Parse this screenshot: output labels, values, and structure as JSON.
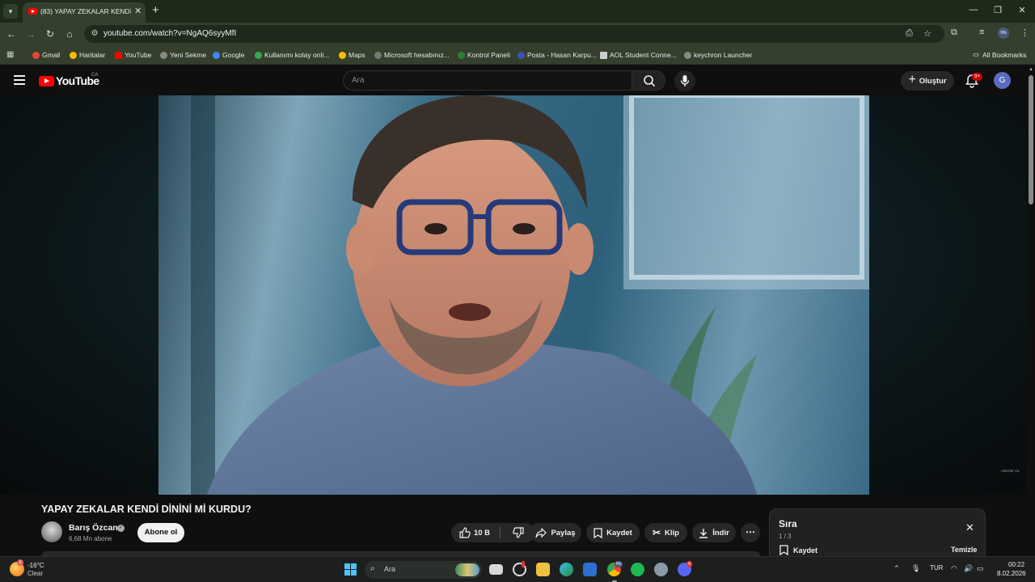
{
  "browser": {
    "tab_title": "(83) YAPAY ZEKALAR KENDİ DİN",
    "url": "youtube.com/watch?v=NgAQ6syyMfI",
    "profile_initials": "Hs",
    "bookmarks": [
      "Gmail",
      "Haritalar",
      "YouTube",
      "Yeni Sekme",
      "Google",
      "Kullanımı kolay onli...",
      "Maps",
      "Microsoft hesabınız...",
      "Kontrol Paneli",
      "Posta - Hasan Karpu...",
      "AOL Student Conne...",
      "keychron Launcher"
    ],
    "bookmark_colors": [
      "#ea4335",
      "#fbbc04",
      "#ff0000",
      "#888888",
      "#4285f4",
      "#34a853",
      "#fbbc04",
      "#777777",
      "#2e7d32",
      "#3f51b5",
      "#cccccc",
      "#888888"
    ],
    "all_bookmarks": "All Bookmarks"
  },
  "youtube": {
    "logo_text": "YouTube",
    "country_code": "CA",
    "search_placeholder": "Ara",
    "create_label": "Oluştur",
    "notification_count": "9+",
    "account_initial": "G"
  },
  "video": {
    "title": "YAPAY ZEKALAR KENDİ DİNİNİ Mİ KURDU?",
    "watermark": "ABONE OL",
    "channel_name": "Barış Özcan",
    "subscribers": "6,68 Mn abone",
    "subscribe_label": "Abone ol",
    "likes": "10 B",
    "share_label": "Paylaş",
    "save_label": "Kaydet",
    "clip_label": "Klip",
    "download_label": "İndir"
  },
  "queue": {
    "title": "Sıra",
    "position": "1 / 3",
    "save_label": "Kaydet",
    "clear_label": "Temizle"
  },
  "taskbar": {
    "weather_temp": "-16°C",
    "weather_condition": "Clear",
    "weather_badge": "1",
    "search_placeholder": "Ara",
    "chrome_badge": "Hs",
    "discord_badge": "4",
    "language": "TUR",
    "time": "00:22",
    "date": "8.02.2026"
  }
}
